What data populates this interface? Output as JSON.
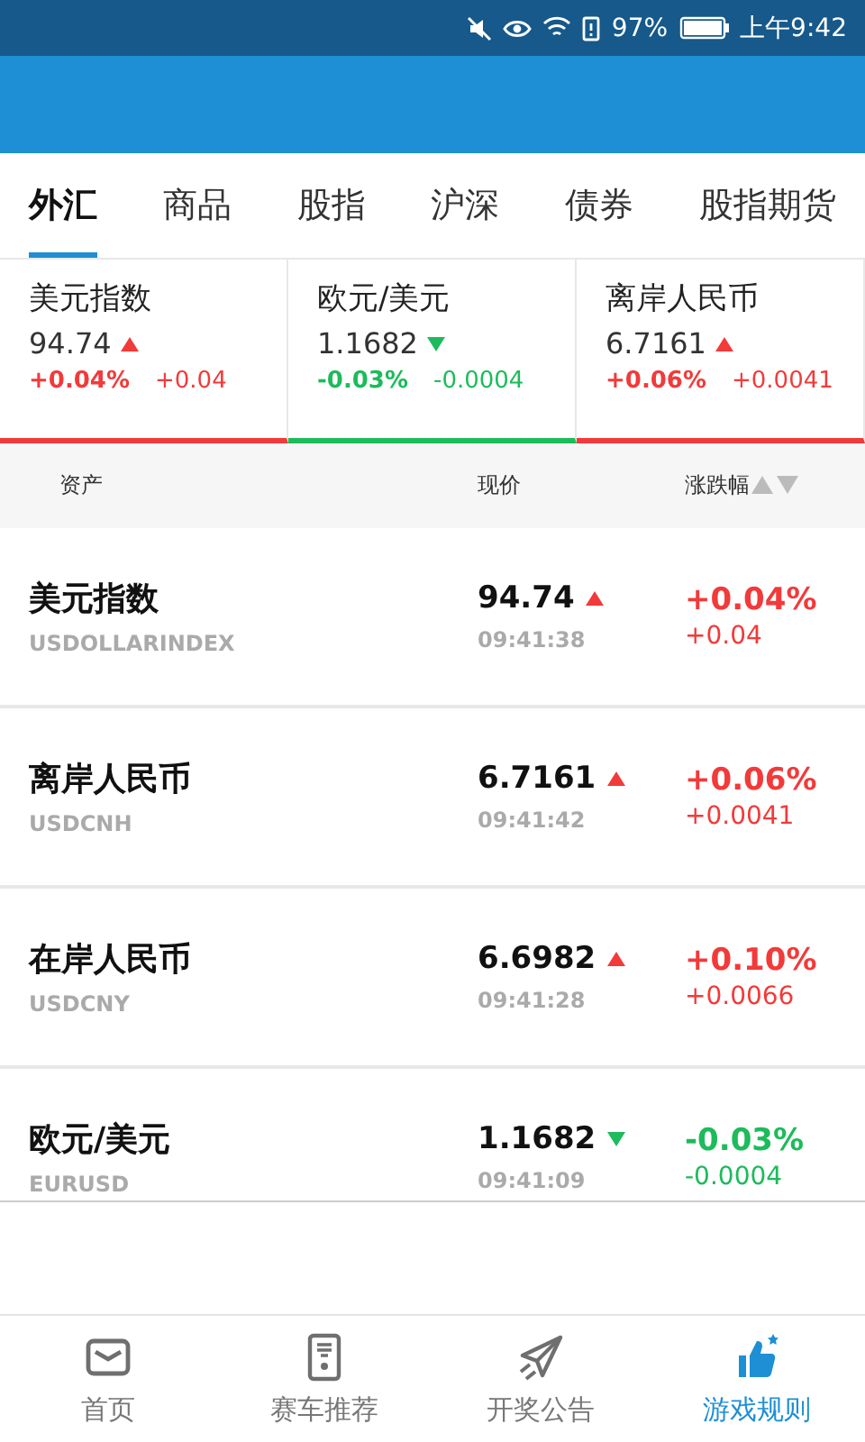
{
  "status_bar": {
    "battery": "97%",
    "time": "上午9:42"
  },
  "tabs": [
    {
      "label": "外汇",
      "selected": true
    },
    {
      "label": "商品",
      "selected": false
    },
    {
      "label": "股指",
      "selected": false
    },
    {
      "label": "沪深",
      "selected": false
    },
    {
      "label": "债券",
      "selected": false
    },
    {
      "label": "股指期货",
      "selected": false
    }
  ],
  "summary_cards": [
    {
      "name": "美元指数",
      "price": "94.74",
      "kind": "up",
      "change_pct": "+0.04%",
      "change": "+0.04"
    },
    {
      "name": "欧元/美元",
      "price": "1.1682",
      "kind": "down",
      "change_pct": "-0.03%",
      "change": "-0.0004"
    },
    {
      "name": "离岸人民币",
      "price": "6.7161",
      "kind": "up",
      "change_pct": "+0.06%",
      "change": "+0.0041"
    }
  ],
  "table": {
    "columns": [
      "资产",
      "现价",
      "涨跌幅"
    ],
    "rows": [
      {
        "name": "美元指数",
        "code": "USDOLLARINDEX",
        "price": "94.74",
        "time": "09:41:38",
        "kind": "up",
        "change_pct": "+0.04%",
        "change": "+0.04"
      },
      {
        "name": "离岸人民币",
        "code": "USDCNH",
        "price": "6.7161",
        "time": "09:41:42",
        "kind": "up",
        "change_pct": "+0.06%",
        "change": "+0.0041"
      },
      {
        "name": "在岸人民币",
        "code": "USDCNY",
        "price": "6.6982",
        "time": "09:41:28",
        "kind": "up",
        "change_pct": "+0.10%",
        "change": "+0.0066"
      },
      {
        "name": "欧元/美元",
        "code": "EURUSD",
        "price": "1.1682",
        "time": "09:41:09",
        "kind": "down",
        "change_pct": "-0.03%",
        "change": "-0.0004"
      }
    ]
  },
  "bottom_nav": [
    {
      "label": "首页",
      "selected": false
    },
    {
      "label": "赛车推荐",
      "selected": false
    },
    {
      "label": "开奖公告",
      "selected": false
    },
    {
      "label": "游戏规则",
      "selected": true
    }
  ]
}
